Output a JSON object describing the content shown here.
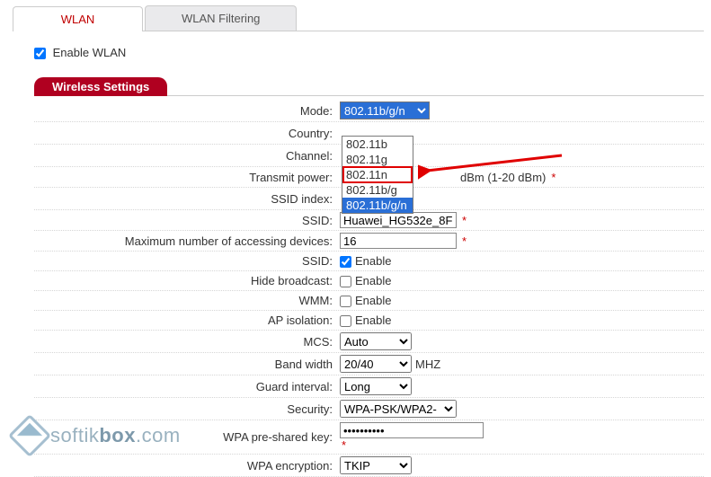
{
  "tabs": {
    "wlan": "WLAN",
    "filtering": "WLAN Filtering"
  },
  "enable_wlan_label": "Enable WLAN",
  "section_title": "Wireless Settings",
  "labels": {
    "mode": "Mode:",
    "country": "Country:",
    "channel": "Channel:",
    "tx_power": "Transmit power:",
    "ssid_index": "SSID index:",
    "ssid": "SSID:",
    "max_devices": "Maximum number of accessing devices:",
    "ssid_enable": "SSID:",
    "hide_bcast": "Hide broadcast:",
    "wmm": "WMM:",
    "ap_iso": "AP isolation:",
    "mcs": "MCS:",
    "bandwidth": "Band width",
    "guard": "Guard interval:",
    "security": "Security:",
    "psk": "WPA pre-shared key:",
    "wpa_enc": "WPA encryption:"
  },
  "values": {
    "mode": "802.11b/g/n",
    "country": "",
    "channel": "",
    "tx_power": "",
    "tx_power_hint": "dBm (1-20 dBm)",
    "ssid_index": "",
    "ssid": "Huawei_HG532e_8F",
    "max_devices": "16",
    "enable_text": "Enable",
    "mcs": "Auto",
    "bandwidth": "20/40",
    "bandwidth_unit": "MHZ",
    "guard": "Long",
    "security": "WPA-PSK/WPA2-",
    "psk": "••••••••••",
    "wpa_enc": "TKIP"
  },
  "mode_options": [
    "802.11b",
    "802.11g",
    "802.11n",
    "802.11b/g",
    "802.11b/g/n"
  ],
  "asterisk": "*",
  "watermark": {
    "brand1": "softik",
    "brand2": "box",
    "tld": ".com"
  }
}
